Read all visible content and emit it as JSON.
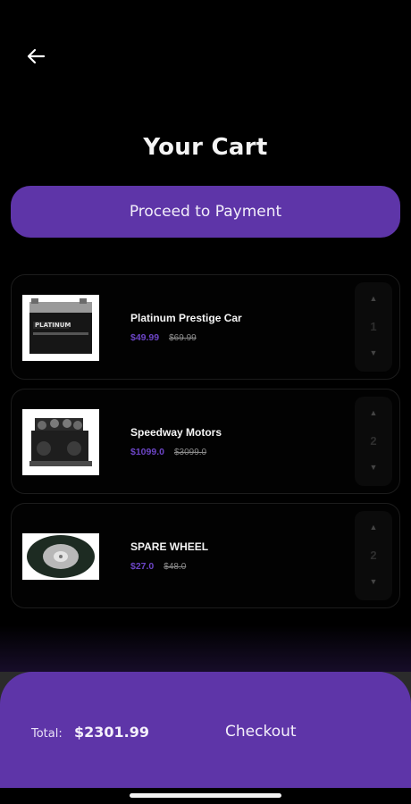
{
  "header": {
    "title": "Your Cart",
    "back_icon": "arrow-left-icon"
  },
  "actions": {
    "proceed_label": "Proceed to Payment"
  },
  "cart": {
    "items": [
      {
        "name": "Platinum Prestige Car",
        "price": "$49.99",
        "old_price": "$69.99",
        "quantity": "1",
        "image": "car-battery"
      },
      {
        "name": "Speedway Motors",
        "price": "$1099.0",
        "old_price": "$3099.0",
        "quantity": "2",
        "image": "engine"
      },
      {
        "name": "SPARE WHEEL",
        "price": "$27.0",
        "old_price": "$48.0",
        "quantity": "2",
        "image": "tyre"
      }
    ]
  },
  "footer": {
    "total_label": "Total:",
    "total_value": "$2301.99",
    "checkout_label": "Checkout"
  },
  "colors": {
    "accent": "#5e35a8",
    "price": "#6c45c6",
    "background": "#000000"
  }
}
